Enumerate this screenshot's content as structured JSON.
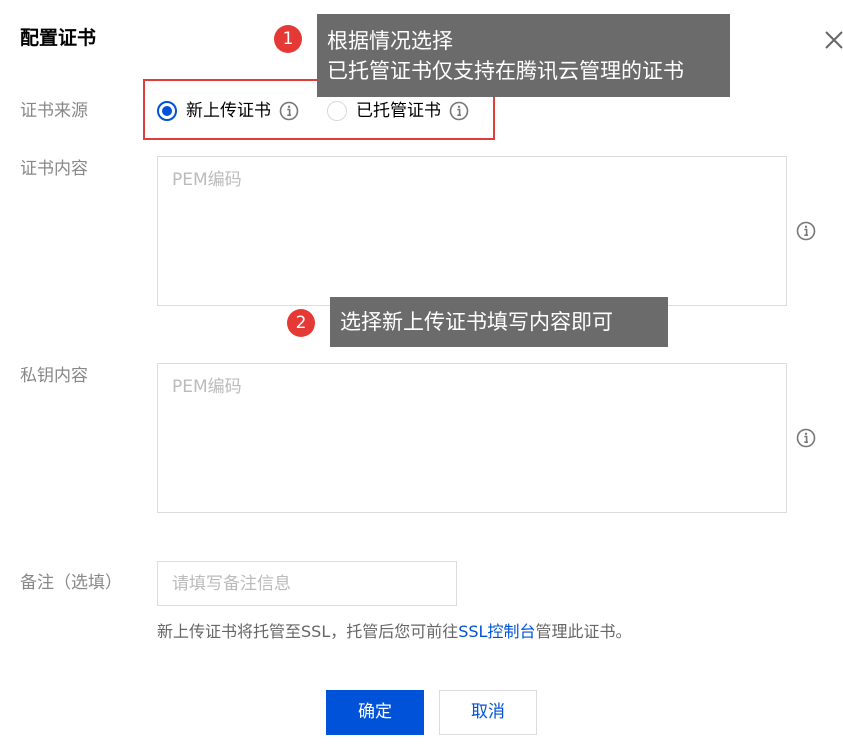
{
  "dialog": {
    "title": "配置证书"
  },
  "form": {
    "cert_source": {
      "label": "证书来源",
      "options": [
        {
          "label": "新上传证书",
          "checked": true
        },
        {
          "label": "已托管证书",
          "checked": false
        }
      ]
    },
    "cert_content": {
      "label": "证书内容",
      "placeholder": "PEM编码",
      "value": ""
    },
    "private_key": {
      "label": "私钥内容",
      "placeholder": "PEM编码",
      "value": ""
    },
    "remark": {
      "label": "备注（选填）",
      "placeholder": "请填写备注信息",
      "value": ""
    },
    "hint": {
      "prefix": "新上传证书将托管至SSL，托管后您可前往",
      "link": "SSL控制台",
      "suffix": "管理此证书。"
    }
  },
  "buttons": {
    "confirm": "确定",
    "cancel": "取消"
  },
  "annotations": [
    {
      "number": "1",
      "line1": "根据情况选择",
      "line2": "已托管证书仅支持在腾讯云管理的证书"
    },
    {
      "number": "2",
      "line1": "选择新上传证书填写内容即可"
    }
  ],
  "colors": {
    "primary": "#0052d9",
    "annotation_badge": "#e53935",
    "annotation_box": "#e03c3c",
    "tooltip_bg": "#6b6b6b"
  },
  "icons": {
    "close": "close-icon",
    "info": "info-icon"
  }
}
